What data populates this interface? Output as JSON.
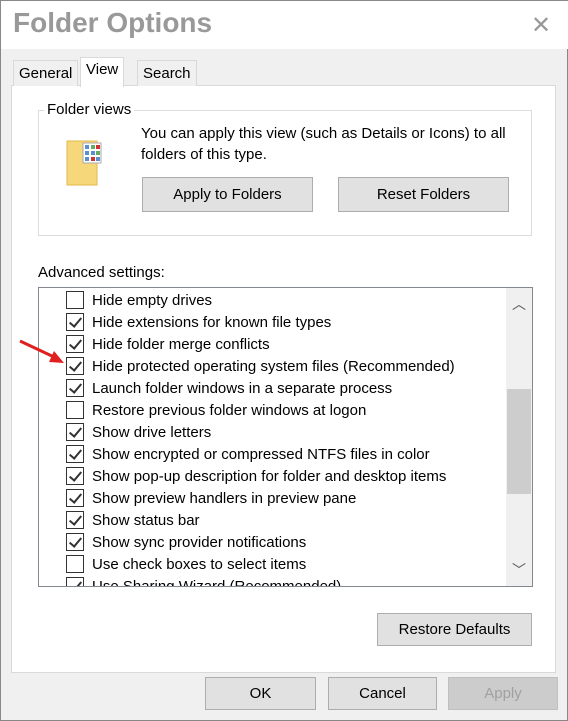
{
  "window": {
    "title": "Folder Options",
    "close_icon": "close-icon"
  },
  "tabs": [
    {
      "label": "General",
      "active": false
    },
    {
      "label": "View",
      "active": true
    },
    {
      "label": "Search",
      "active": false
    }
  ],
  "folder_views": {
    "label": "Folder views",
    "description": "You can apply this view (such as Details or Icons) to all folders of this type.",
    "apply_label": "Apply to Folders",
    "reset_label": "Reset Folders"
  },
  "advanced": {
    "label": "Advanced settings:",
    "items": [
      {
        "label": "Hide empty drives",
        "checked": false
      },
      {
        "label": "Hide extensions for known file types",
        "checked": true
      },
      {
        "label": "Hide folder merge conflicts",
        "checked": true
      },
      {
        "label": "Hide protected operating system files (Recommended)",
        "checked": true
      },
      {
        "label": "Launch folder windows in a separate process",
        "checked": true
      },
      {
        "label": "Restore previous folder windows at logon",
        "checked": false
      },
      {
        "label": "Show drive letters",
        "checked": true
      },
      {
        "label": "Show encrypted or compressed NTFS files in color",
        "checked": true
      },
      {
        "label": "Show pop-up description for folder and desktop items",
        "checked": true
      },
      {
        "label": "Show preview handlers in preview pane",
        "checked": true
      },
      {
        "label": "Show status bar",
        "checked": true
      },
      {
        "label": "Show sync provider notifications",
        "checked": true
      },
      {
        "label": "Use check boxes to select items",
        "checked": false
      },
      {
        "label": "Use Sharing Wizard (Recommended)",
        "checked": true
      }
    ],
    "restore_label": "Restore Defaults"
  },
  "footer": {
    "ok": "OK",
    "cancel": "Cancel",
    "apply": "Apply"
  },
  "annotation": {
    "arrow_color": "#e02020"
  }
}
